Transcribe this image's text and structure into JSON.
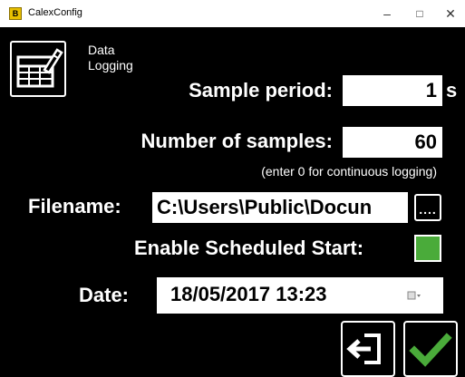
{
  "window": {
    "app_icon_letter": "B",
    "title": "CalexConfig",
    "minimize": "–",
    "maximize": "□",
    "close": "✕"
  },
  "section": {
    "title": "Data Logging",
    "icon": "table-edit-icon"
  },
  "form": {
    "sample_period_label": "Sample period:",
    "sample_period_value": "1",
    "sample_period_unit": "s",
    "num_samples_label": "Number of samples:",
    "num_samples_value": "60",
    "num_samples_hint": "(enter 0 for continuous logging)",
    "filename_label": "Filename:",
    "filename_value": "C:\\Users\\Public\\Docun",
    "browse_label": "....",
    "scheduled_start_label": "Enable Scheduled Start:",
    "scheduled_start_checked": true,
    "date_label": "Date:",
    "date_value": "18/05/2017   13:23"
  },
  "actions": {
    "exit_icon": "exit-icon",
    "confirm_icon": "checkmark-icon"
  },
  "colors": {
    "background": "#000000",
    "text": "#ffffff",
    "check_green": "#4aab3a",
    "titlebar": "#ffffff"
  }
}
